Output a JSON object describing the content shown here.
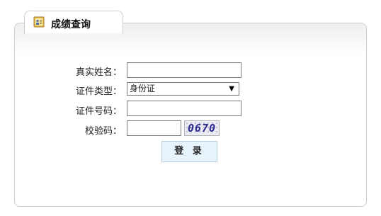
{
  "panel": {
    "title": "成绩查询",
    "icon": "id-card-icon"
  },
  "form": {
    "name_label": "真实姓名：",
    "id_type_label": "证件类型：",
    "id_type_value": "身份证",
    "id_number_label": "证件号码：",
    "captcha_label": "校验码：",
    "captcha_text": "0670",
    "login_label": "登 录"
  }
}
